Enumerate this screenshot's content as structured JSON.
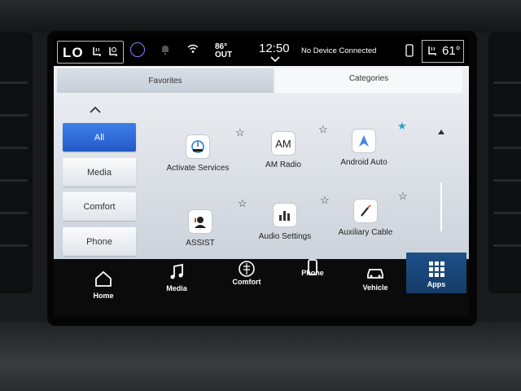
{
  "status_bar": {
    "hvac_mode": "LO",
    "outside_temp": "86°",
    "outside_label": "OUT",
    "time": "12:50",
    "device_status": "No Device Connected",
    "right_temp": "61°",
    "icons": [
      "heated-seat-icon",
      "ventilated-seat-icon",
      "profile-icon",
      "notification-bell-icon",
      "wifi-icon",
      "phone-icon",
      "heated-seat-icon"
    ]
  },
  "tabs": [
    {
      "label": "Favorites",
      "selected": false
    },
    {
      "label": "Categories",
      "selected": true
    }
  ],
  "categories": [
    {
      "label": "All",
      "selected": true
    },
    {
      "label": "Media",
      "selected": false
    },
    {
      "label": "Comfort",
      "selected": false
    },
    {
      "label": "Phone",
      "selected": false
    }
  ],
  "apps": [
    {
      "label": "Activate Services",
      "icon": "activate-services-icon",
      "favorite": false
    },
    {
      "label": "AM Radio",
      "icon": "am-radio-icon",
      "icon_text": "AM",
      "favorite": false
    },
    {
      "label": "Android Auto",
      "icon": "android-auto-icon",
      "favorite": true
    },
    {
      "label": "ASSIST",
      "icon": "assist-icon",
      "favorite": false
    },
    {
      "label": "Audio Settings",
      "icon": "audio-settings-icon",
      "favorite": false
    },
    {
      "label": "Auxiliary Cable",
      "icon": "auxiliary-cable-icon",
      "favorite": false
    }
  ],
  "nav": [
    {
      "label": "Home",
      "icon": "home-icon",
      "active": false
    },
    {
      "label": "Media",
      "icon": "music-note-icon",
      "active": false
    },
    {
      "label": "Comfort",
      "icon": "climate-icon",
      "active": false
    },
    {
      "label": "Phone",
      "icon": "phone-icon",
      "active": false
    },
    {
      "label": "Vehicle",
      "icon": "car-icon",
      "active": false
    },
    {
      "label": "Apps",
      "icon": "apps-grid-icon",
      "active": true
    }
  ],
  "colors": {
    "accent": "#2f6fdb",
    "favorite_star": "#1fa6c9",
    "active_nav": "#1d4f88"
  }
}
